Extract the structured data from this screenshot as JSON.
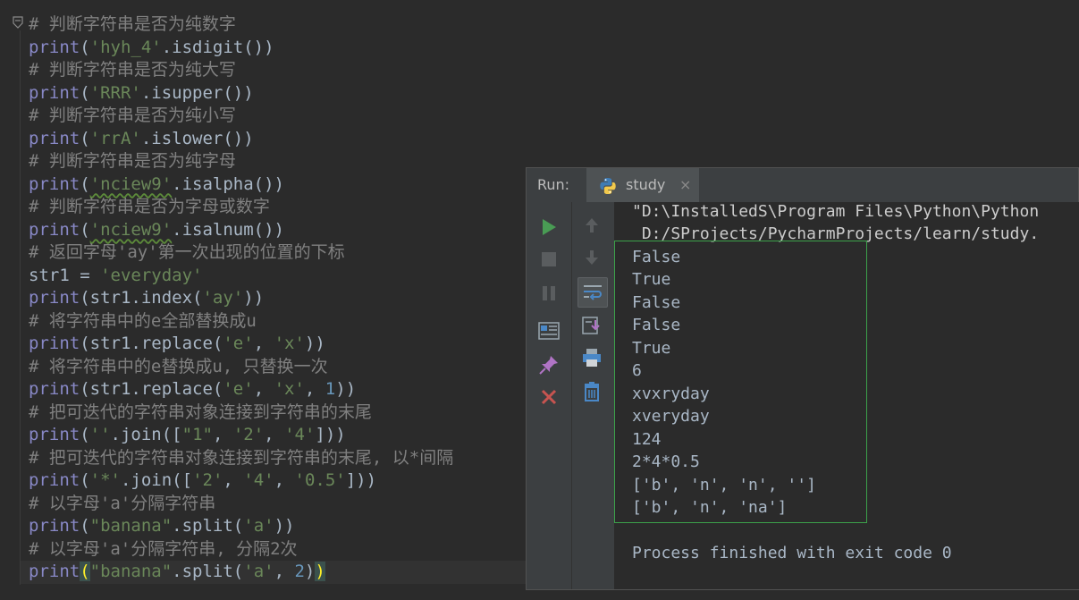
{
  "editor": {
    "lines": [
      {
        "comment": "# 判断字符串是否为纯数字"
      },
      {
        "prefix": "print(",
        "str": "'hyh_4'",
        "suffix": ".isdigit())"
      },
      {
        "comment": "# 判断字符串是否为纯大写"
      },
      {
        "prefix": "print(",
        "str": "'RRR'",
        "suffix": ".isupper())"
      },
      {
        "comment": "# 判断字符串是否为纯小写"
      },
      {
        "prefix": "print(",
        "str": "'rrA'",
        "suffix": ".islower())"
      },
      {
        "comment": "# 判断字符串是否为纯字母"
      },
      {
        "prefix": "print(",
        "str": "'nciew9'",
        "suffix": ".isalpha())"
      },
      {
        "comment": "# 判断字符串是否为字母或数字"
      },
      {
        "prefix": "print(",
        "str": "'nciew9'",
        "suffix": ".isalnum())"
      },
      {
        "comment": "# 返回字母'ay'第一次出现的位置的下标"
      },
      {
        "assign_lhs": "str1 = ",
        "str": "'everyday'"
      },
      {
        "prefix": "print(str1.index(",
        "str": "'ay'",
        "suffix": "))"
      },
      {
        "comment": "# 将字符串中的e全部替换成u"
      },
      {
        "prefix": "print(str1.replace(",
        "str": "'e'",
        "mid": ", ",
        "str2": "'x'",
        "suffix": "))"
      },
      {
        "comment": "# 将字符串中的e替换成u, 只替换一次"
      },
      {
        "prefix": "print(str1.replace(",
        "str": "'e'",
        "mid": ", ",
        "str2": "'x'",
        "mid2": ", ",
        "num": "1",
        "suffix": "))"
      },
      {
        "comment": "# 把可迭代的字符串对象连接到字符串的末尾"
      },
      {
        "prefix": "print(",
        "str": "''",
        "mid": ".join([",
        "str2": "\"1\"",
        "mid2": ", ",
        "str3": "'2'",
        "mid3": ", ",
        "str4": "'4'",
        "suffix": "]))"
      },
      {
        "comment": "# 把可迭代的字符串对象连接到字符串的末尾, 以*间隔"
      },
      {
        "prefix": "print(",
        "str": "'*'",
        "mid": ".join([",
        "str2": "'2'",
        "mid2": ", ",
        "str3": "'4'",
        "mid3": ", ",
        "str4": "'0.5'",
        "suffix": "]))"
      },
      {
        "comment": "# 以字母'a'分隔字符串"
      },
      {
        "prefix": "print(",
        "str": "\"banana\"",
        "mid": ".split(",
        "str2": "'a'",
        "suffix": "))"
      },
      {
        "comment": "# 以字母'a'分隔字符串, 分隔2次"
      },
      {
        "prefix": "print",
        "paren_open": "(",
        "str": "\"banana\"",
        "mid": ".split(",
        "str2": "'a'",
        "mid2": ", ",
        "num": "2",
        "suffix": ")",
        "paren_close": ")"
      }
    ]
  },
  "run_panel": {
    "title": "Run:",
    "tab_label": "study",
    "tab_close": "×",
    "command_line_1": "\"D:\\InstalledS\\Program Files\\Python\\Python",
    "command_line_2": " D:/SProjects/PycharmProjects/learn/study.",
    "output": [
      "False",
      "True",
      "False",
      "False",
      "True",
      "6",
      "xvxryday",
      "xveryday",
      "124",
      "2*4*0.5",
      "['b', 'n', 'n', '']",
      "['b', 'n', 'na']"
    ],
    "exit_message": "Process finished with exit code 0"
  },
  "colors": {
    "editor_bg": "#2b2b2b",
    "keyword": "#8888c6",
    "string": "#6a8759",
    "comment": "#808080",
    "number": "#6897bb",
    "run_green": "#499c54",
    "stop_red": "#c75450",
    "selection_border": "#3ca14a"
  },
  "icons": [
    "fold-icon",
    "python-icon",
    "run-icon",
    "stop-icon",
    "pause-icon",
    "up-arrow-icon",
    "down-arrow-icon",
    "soft-wrap-icon",
    "scroll-to-end-icon",
    "layout-icon",
    "print-icon",
    "pin-icon",
    "trash-icon",
    "close-icon"
  ]
}
